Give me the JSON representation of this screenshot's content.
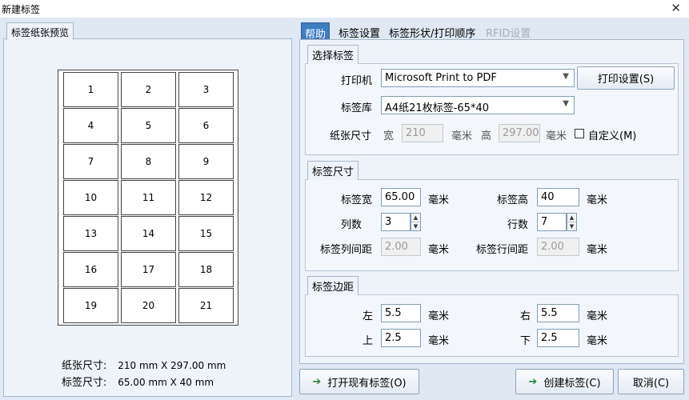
{
  "window": {
    "title": "新建标签",
    "close_glyph": "✕"
  },
  "preview": {
    "tab_label": "标签纸张预览",
    "cells": [
      "1",
      "2",
      "3",
      "4",
      "5",
      "6",
      "7",
      "8",
      "9",
      "10",
      "11",
      "12",
      "13",
      "14",
      "15",
      "16",
      "17",
      "18",
      "19",
      "20",
      "21"
    ],
    "paper_size_label": "纸张尺寸:",
    "paper_size_value": "210 mm X 297.00 mm",
    "label_size_label": "标签尺寸:",
    "label_size_value": "65.00 mm X 40 mm"
  },
  "tabs": [
    {
      "label": "帮助",
      "active": true
    },
    {
      "label": "标签设置"
    },
    {
      "label": "标签形状/打印顺序"
    },
    {
      "label": "RFID设置",
      "disabled": true
    }
  ],
  "select_label": {
    "title": "选择标签",
    "printer_label": "打印机",
    "printer_value": "Microsoft Print to PDF",
    "print_settings_button": "打印设置(S)",
    "library_label": "标签库",
    "library_value": "A4纸21枚标签-65*40",
    "paper_size_label": "纸张尺寸",
    "width_label": "宽",
    "width_value": "210",
    "height_label": "高",
    "height_value": "297.00",
    "unit": "毫米",
    "custom_label": "自定义(M)"
  },
  "label_size": {
    "title": "标签尺寸",
    "width_label": "标签宽",
    "width_value": "65.00",
    "height_label": "标签高",
    "height_value": "40",
    "cols_label": "列数",
    "cols_value": "3",
    "rows_label": "行数",
    "rows_value": "7",
    "col_gap_label": "标签列间距",
    "col_gap_value": "2.00",
    "row_gap_label": "标签行间距",
    "row_gap_value": "2.00",
    "unit": "毫米"
  },
  "margins": {
    "title": "标签边距",
    "left_label": "左",
    "left_value": "5.5",
    "right_label": "右",
    "right_value": "5.5",
    "top_label": "上",
    "top_value": "2.5",
    "bottom_label": "下",
    "bottom_value": "2.5",
    "unit": "毫米"
  },
  "buttons": {
    "open_existing": "打开现有标签(O)",
    "create": "创建标签(C)",
    "cancel": "取消(C)",
    "arrow_glyph": "➔"
  },
  "icons": {
    "dropdown": "▼",
    "spin_up": "▲",
    "spin_down": "▼"
  }
}
